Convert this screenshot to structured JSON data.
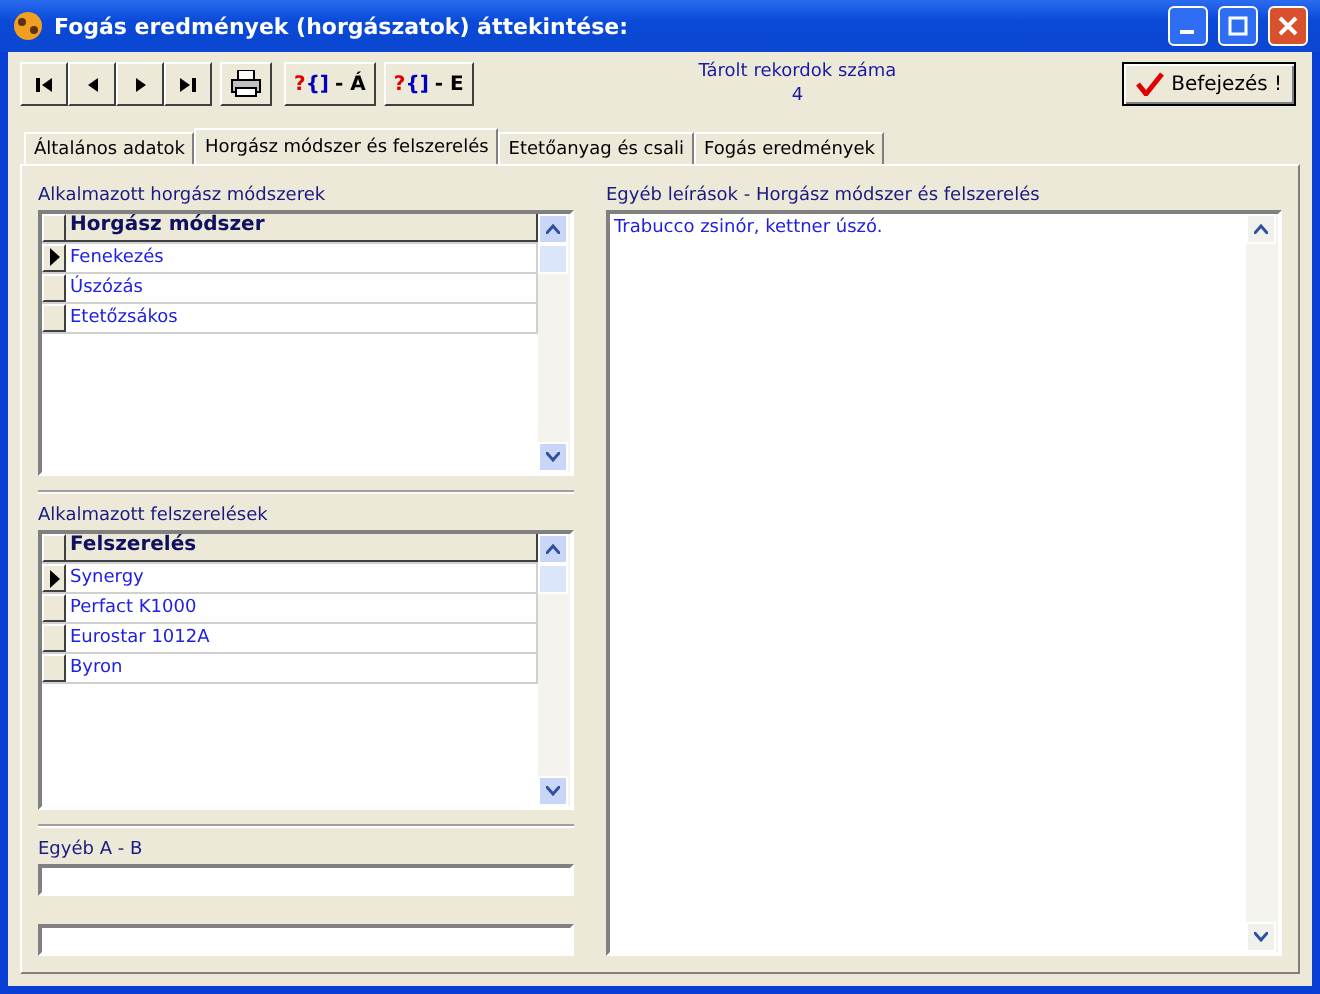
{
  "window": {
    "title": "Fogás eredmények (horgászatok) áttekintése:"
  },
  "toolbar": {
    "nav_buttons": [
      {
        "kind": "first"
      },
      {
        "kind": "prev"
      },
      {
        "kind": "next"
      },
      {
        "kind": "last"
      }
    ],
    "query_buttons": [
      {
        "mark": "?",
        "brace": "{]",
        "label": "- Á"
      },
      {
        "mark": "?",
        "brace": "{]",
        "label": "- E"
      }
    ],
    "record_count": {
      "label": "Tárolt rekordok száma",
      "value": "4"
    },
    "finish_button": "Befejezés !"
  },
  "tabs": [
    {
      "label": "Általános adatok",
      "selected": false
    },
    {
      "label": "Horgász módszer és felszerelés",
      "selected": true
    },
    {
      "label": "Etetőanyag és csali",
      "selected": false
    },
    {
      "label": "Fogás eredmények",
      "selected": false
    }
  ],
  "methods": {
    "label": "Alkalmazott horgász módszerek",
    "column": "Horgász módszer",
    "rows": [
      {
        "value": "Fenekezés",
        "selected": true
      },
      {
        "value": "Úszózás",
        "selected": false
      },
      {
        "value": "Etetőzsákos",
        "selected": false
      }
    ]
  },
  "equipment": {
    "label": "Alkalmazott felszerelések",
    "column": "Felszerelés",
    "rows": [
      {
        "value": "Synergy",
        "selected": true
      },
      {
        "value": "Perfact K1000",
        "selected": false
      },
      {
        "value": "Eurostar 1012A",
        "selected": false
      },
      {
        "value": "Byron",
        "selected": false
      }
    ]
  },
  "other_ab": {
    "label": "Egyéb A - B"
  },
  "notes": {
    "label": "Egyéb leírások - Horgász módszer és felszerelés",
    "value": "Trabucco zsinór, kettner úszó."
  }
}
